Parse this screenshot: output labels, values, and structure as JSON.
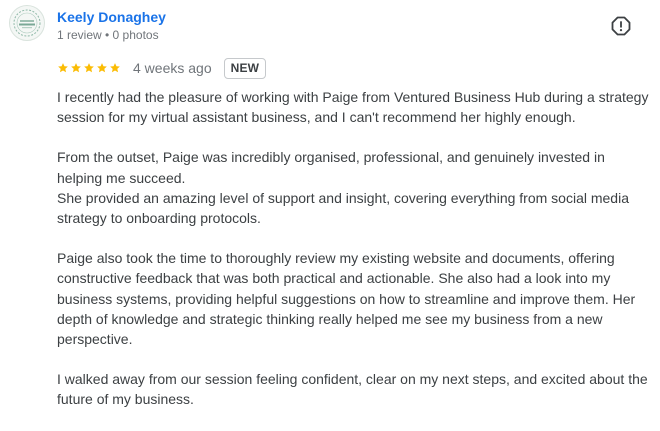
{
  "review": {
    "author": {
      "name": "Keely Donaghey",
      "meta": "1 review • 0 photos",
      "avatar_icon": "circular-logo-avatar"
    },
    "flag_icon": "report-alert-icon",
    "rating": {
      "stars": 5,
      "max_stars": 5,
      "star_color": "#fbbc04",
      "date": "4 weeks ago",
      "badge": "NEW"
    },
    "paragraphs": [
      {
        "lines": [
          "I recently had the pleasure of working with Paige from Ventured Business Hub during a strategy session for my virtual assistant business, and I can't recommend her highly enough."
        ]
      },
      {
        "lines": [
          "From the outset, Paige was incredibly organised, professional, and genuinely invested in helping me succeed.",
          "She provided an amazing level of support and insight, covering everything from social media strategy to onboarding protocols."
        ]
      },
      {
        "lines": [
          "Paige also took the time to thoroughly review my existing website and documents, offering constructive feedback that was both practical and actionable. She also had a look into my business systems, providing helpful suggestions on how to streamline and improve them. Her depth of knowledge and strategic thinking really helped me see my business from a new perspective."
        ]
      },
      {
        "lines": [
          "I walked away from our session feeling confident, clear on my next steps, and excited about the future of my business."
        ]
      }
    ]
  }
}
